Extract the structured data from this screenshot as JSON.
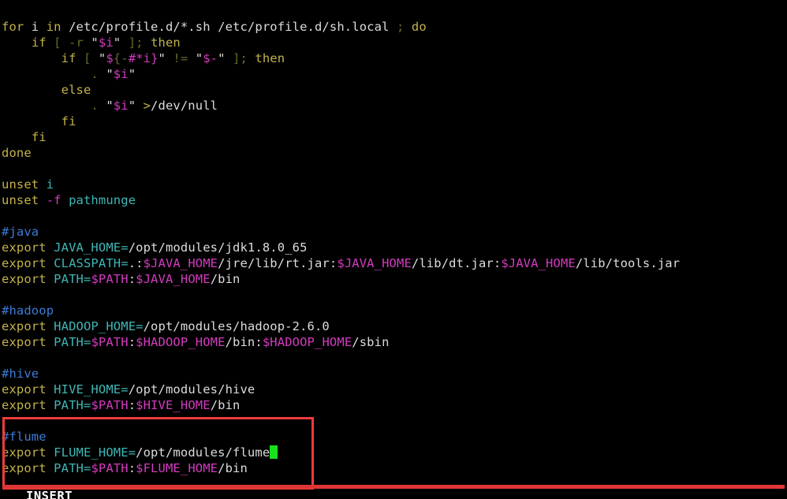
{
  "app": {
    "type": "terminal-text-editor",
    "editor": "vim",
    "background_color": "#000000",
    "foreground_color": "#dcdcdc"
  },
  "palette": {
    "keyword": "#c4b14a",
    "comment": "#3c7bd6",
    "identifier": "#3fb6b6",
    "variable": "#d33bbf",
    "plain": "#dcdcdc",
    "punctuation": "#6a6a2a",
    "cursor": "#19e019",
    "annotation": "#f23b3b"
  },
  "editor": {
    "cursor": {
      "line_index": 27,
      "shape": "block",
      "color": "#19e019",
      "after_text": "export FLUME_HOME=/opt/modules/flume"
    },
    "lines": [
      {
        "index": 0,
        "text": "for i in /etc/profile.d/*.sh /etc/profile.d/sh.local ; do",
        "tokens": [
          {
            "t": "for",
            "c": "kw"
          },
          {
            "t": " i ",
            "c": "plain"
          },
          {
            "t": "in",
            "c": "kw"
          },
          {
            "t": " /etc/profile.d/*.sh /etc/profile.d/sh.local ",
            "c": "plain"
          },
          {
            "t": ";",
            "c": "dim"
          },
          {
            "t": " ",
            "c": "plain"
          },
          {
            "t": "do",
            "c": "kw"
          }
        ]
      },
      {
        "index": 1,
        "text": "    if [ -r \"$i\" ]; then",
        "tokens": [
          {
            "t": "    ",
            "c": "plain"
          },
          {
            "t": "if",
            "c": "kw"
          },
          {
            "t": " ",
            "c": "plain"
          },
          {
            "t": "[",
            "c": "dim"
          },
          {
            "t": " ",
            "c": "plain"
          },
          {
            "t": "-r",
            "c": "dim"
          },
          {
            "t": " \"",
            "c": "plain"
          },
          {
            "t": "$i",
            "c": "var"
          },
          {
            "t": "\" ",
            "c": "plain"
          },
          {
            "t": "]",
            "c": "dim"
          },
          {
            "t": ";",
            "c": "dim"
          },
          {
            "t": " ",
            "c": "plain"
          },
          {
            "t": "then",
            "c": "kw"
          }
        ]
      },
      {
        "index": 2,
        "text": "        if [ \"${-#*i}\" != \"$-\" ]; then",
        "tokens": [
          {
            "t": "        ",
            "c": "plain"
          },
          {
            "t": "if",
            "c": "kw"
          },
          {
            "t": " ",
            "c": "plain"
          },
          {
            "t": "[",
            "c": "dim"
          },
          {
            "t": " \"",
            "c": "plain"
          },
          {
            "t": "$",
            "c": "var"
          },
          {
            "t": "{",
            "c": "dim"
          },
          {
            "t": "-",
            "c": "dim"
          },
          {
            "t": "#*i",
            "c": "var"
          },
          {
            "t": "}",
            "c": "var"
          },
          {
            "t": "\" ",
            "c": "plain"
          },
          {
            "t": "!=",
            "c": "dim"
          },
          {
            "t": " \"",
            "c": "plain"
          },
          {
            "t": "$-",
            "c": "var"
          },
          {
            "t": "\" ",
            "c": "plain"
          },
          {
            "t": "]",
            "c": "dim"
          },
          {
            "t": ";",
            "c": "dim"
          },
          {
            "t": " ",
            "c": "plain"
          },
          {
            "t": "then",
            "c": "kw"
          }
        ]
      },
      {
        "index": 3,
        "text": "            . \"$i\"",
        "tokens": [
          {
            "t": "            ",
            "c": "plain"
          },
          {
            "t": ".",
            "c": "dim"
          },
          {
            "t": " \"",
            "c": "plain"
          },
          {
            "t": "$i",
            "c": "var"
          },
          {
            "t": "\"",
            "c": "plain"
          }
        ]
      },
      {
        "index": 4,
        "text": "        else",
        "tokens": [
          {
            "t": "        ",
            "c": "plain"
          },
          {
            "t": "else",
            "c": "kw"
          }
        ]
      },
      {
        "index": 5,
        "text": "            . \"$i\" >/dev/null",
        "tokens": [
          {
            "t": "            ",
            "c": "plain"
          },
          {
            "t": ".",
            "c": "dim"
          },
          {
            "t": " \"",
            "c": "plain"
          },
          {
            "t": "$i",
            "c": "var"
          },
          {
            "t": "\" ",
            "c": "plain"
          },
          {
            "t": ">",
            "c": "op"
          },
          {
            "t": "/dev/null",
            "c": "plain"
          }
        ]
      },
      {
        "index": 6,
        "text": "        fi",
        "tokens": [
          {
            "t": "        ",
            "c": "plain"
          },
          {
            "t": "fi",
            "c": "kw"
          }
        ]
      },
      {
        "index": 7,
        "text": "    fi",
        "tokens": [
          {
            "t": "    ",
            "c": "plain"
          },
          {
            "t": "fi",
            "c": "kw"
          }
        ]
      },
      {
        "index": 8,
        "text": "done",
        "tokens": [
          {
            "t": "done",
            "c": "kw"
          }
        ]
      },
      {
        "index": 9,
        "text": "",
        "tokens": []
      },
      {
        "index": 10,
        "text": "unset i",
        "tokens": [
          {
            "t": "unset",
            "c": "kw"
          },
          {
            "t": " ",
            "c": "plain"
          },
          {
            "t": "i",
            "c": "ident"
          }
        ]
      },
      {
        "index": 11,
        "text": "unset -f pathmunge",
        "tokens": [
          {
            "t": "unset",
            "c": "kw"
          },
          {
            "t": " ",
            "c": "plain"
          },
          {
            "t": "-f",
            "c": "var"
          },
          {
            "t": " ",
            "c": "plain"
          },
          {
            "t": "pathmunge",
            "c": "ident"
          }
        ]
      },
      {
        "index": 12,
        "text": "",
        "tokens": []
      },
      {
        "index": 13,
        "text": "#java",
        "tokens": [
          {
            "t": "#java",
            "c": "comment"
          }
        ]
      },
      {
        "index": 14,
        "text": "export JAVA_HOME=/opt/modules/jdk1.8.0_65",
        "tokens": [
          {
            "t": "export",
            "c": "kw"
          },
          {
            "t": " ",
            "c": "plain"
          },
          {
            "t": "JAVA_HOME=",
            "c": "ident"
          },
          {
            "t": "/opt/modules/jdk1.8.0_65",
            "c": "plain"
          }
        ]
      },
      {
        "index": 15,
        "text": "export CLASSPATH=.:$JAVA_HOME/jre/lib/rt.jar:$JAVA_HOME/lib/dt.jar:$JAVA_HOME/lib/tools.jar",
        "tokens": [
          {
            "t": "export",
            "c": "kw"
          },
          {
            "t": " ",
            "c": "plain"
          },
          {
            "t": "CLASSPATH=",
            "c": "ident"
          },
          {
            "t": ".:",
            "c": "plain"
          },
          {
            "t": "$JAVA_HOME",
            "c": "var"
          },
          {
            "t": "/jre/lib/rt.jar:",
            "c": "plain"
          },
          {
            "t": "$JAVA_HOME",
            "c": "var"
          },
          {
            "t": "/lib/dt.jar:",
            "c": "plain"
          },
          {
            "t": "$JAVA_HOME",
            "c": "var"
          },
          {
            "t": "/lib/tools.jar",
            "c": "plain"
          }
        ]
      },
      {
        "index": 16,
        "text": "export PATH=$PATH:$JAVA_HOME/bin",
        "tokens": [
          {
            "t": "export",
            "c": "kw"
          },
          {
            "t": " ",
            "c": "plain"
          },
          {
            "t": "PATH=",
            "c": "ident"
          },
          {
            "t": "$PATH",
            "c": "var"
          },
          {
            "t": ":",
            "c": "plain"
          },
          {
            "t": "$JAVA_HOME",
            "c": "var"
          },
          {
            "t": "/bin",
            "c": "plain"
          }
        ]
      },
      {
        "index": 17,
        "text": "",
        "tokens": []
      },
      {
        "index": 18,
        "text": "#hadoop",
        "tokens": [
          {
            "t": "#hadoop",
            "c": "comment"
          }
        ]
      },
      {
        "index": 19,
        "text": "export HADOOP_HOME=/opt/modules/hadoop-2.6.0",
        "tokens": [
          {
            "t": "export",
            "c": "kw"
          },
          {
            "t": " ",
            "c": "plain"
          },
          {
            "t": "HADOOP_HOME=",
            "c": "ident"
          },
          {
            "t": "/opt/modules/hadoop-2.6.0",
            "c": "plain"
          }
        ]
      },
      {
        "index": 20,
        "text": "export PATH=$PATH:$HADOOP_HOME/bin:$HADOOP_HOME/sbin",
        "tokens": [
          {
            "t": "export",
            "c": "kw"
          },
          {
            "t": " ",
            "c": "plain"
          },
          {
            "t": "PATH=",
            "c": "ident"
          },
          {
            "t": "$PATH",
            "c": "var"
          },
          {
            "t": ":",
            "c": "plain"
          },
          {
            "t": "$HADOOP_HOME",
            "c": "var"
          },
          {
            "t": "/bin:",
            "c": "plain"
          },
          {
            "t": "$HADOOP_HOME",
            "c": "var"
          },
          {
            "t": "/sbin",
            "c": "plain"
          }
        ]
      },
      {
        "index": 21,
        "text": "",
        "tokens": []
      },
      {
        "index": 22,
        "text": "#hive",
        "tokens": [
          {
            "t": "#hive",
            "c": "comment"
          }
        ]
      },
      {
        "index": 23,
        "text": "export HIVE_HOME=/opt/modules/hive",
        "tokens": [
          {
            "t": "export",
            "c": "kw"
          },
          {
            "t": " ",
            "c": "plain"
          },
          {
            "t": "HIVE_HOME=",
            "c": "ident"
          },
          {
            "t": "/opt/modules/hive",
            "c": "plain"
          }
        ]
      },
      {
        "index": 24,
        "text": "export PATH=$PATH:$HIVE_HOME/bin",
        "tokens": [
          {
            "t": "export",
            "c": "kw"
          },
          {
            "t": " ",
            "c": "plain"
          },
          {
            "t": "PATH=",
            "c": "ident"
          },
          {
            "t": "$PATH",
            "c": "var"
          },
          {
            "t": ":",
            "c": "plain"
          },
          {
            "t": "$HIVE_HOME",
            "c": "var"
          },
          {
            "t": "/bin",
            "c": "plain"
          }
        ]
      },
      {
        "index": 25,
        "text": "",
        "tokens": []
      },
      {
        "index": 26,
        "text": "#flume",
        "tokens": [
          {
            "t": "#flume",
            "c": "comment"
          }
        ]
      },
      {
        "index": 27,
        "text": "export FLUME_HOME=/opt/modules/flume",
        "tokens": [
          {
            "t": "export",
            "c": "kw"
          },
          {
            "t": " ",
            "c": "plain"
          },
          {
            "t": "FLUME_HOME=",
            "c": "ident"
          },
          {
            "t": "/opt/modules/flume",
            "c": "plain"
          }
        ],
        "cursor_at_end": true
      },
      {
        "index": 28,
        "text": "export PATH=$PATH:$FLUME_HOME/bin",
        "tokens": [
          {
            "t": "export",
            "c": "kw"
          },
          {
            "t": " ",
            "c": "plain"
          },
          {
            "t": "PATH=",
            "c": "ident"
          },
          {
            "t": "$PATH",
            "c": "var"
          },
          {
            "t": ":",
            "c": "plain"
          },
          {
            "t": "$FLUME_HOME",
            "c": "var"
          },
          {
            "t": "/bin",
            "c": "plain"
          }
        ]
      }
    ]
  },
  "annotations": {
    "highlight_box": {
      "shape": "rectangle",
      "color": "#f23b3b",
      "surrounds_lines": [
        "#flume",
        "export FLUME_HOME=/opt/modules/flume",
        "export PATH=$PATH:$FLUME_HOME/bin"
      ]
    },
    "underline_bar": {
      "shape": "bar",
      "color": "#e03535"
    }
  },
  "status": {
    "mode": "INSERT"
  }
}
